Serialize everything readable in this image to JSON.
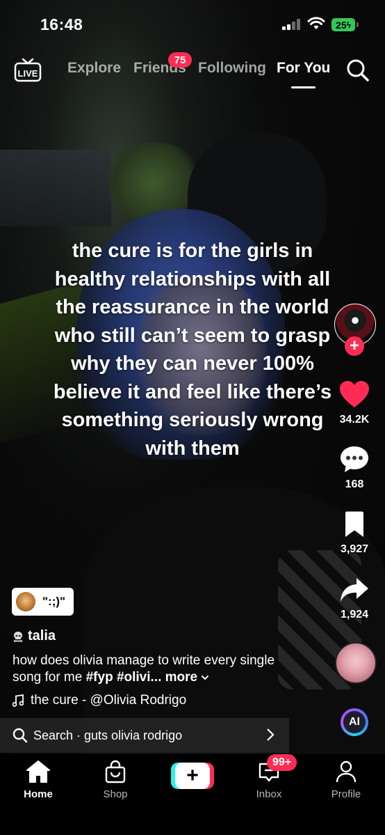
{
  "status_bar": {
    "time": "16:48",
    "battery": "25"
  },
  "top_nav": {
    "live_label": "LIVE",
    "tabs": [
      "Explore",
      "Friends",
      "Following",
      "For You"
    ],
    "active_tab": "For You",
    "friends_badge": "75"
  },
  "video": {
    "caption": "the cure is for the girls in healthy relationships with all the reassurance in the world who still can’t seem to grasp why they can never 100% believe it and feel like there’s something seriously wrong with them"
  },
  "actions": {
    "likes": "34.2K",
    "comments": "168",
    "saves": "3,927",
    "shares": "1,924"
  },
  "sticker": {
    "text": "\":;)\""
  },
  "post": {
    "author": "talia",
    "description": "how does olivia manage to write every single song for me ",
    "hashtags": "#fyp #olivi...",
    "more_label": "more",
    "sound": "the cure - @Olivia Rodrigo"
  },
  "search_suggestion": {
    "prefix": "Search · ",
    "query": "guts olivia rodrigo"
  },
  "ai_label": "AI",
  "bottom_nav": {
    "home": "Home",
    "shop": "Shop",
    "inbox": "Inbox",
    "profile": "Profile",
    "inbox_badge": "99+"
  },
  "colors": {
    "accent": "#fe2c55",
    "cyan": "#25f4ee",
    "battery": "#33c759"
  }
}
